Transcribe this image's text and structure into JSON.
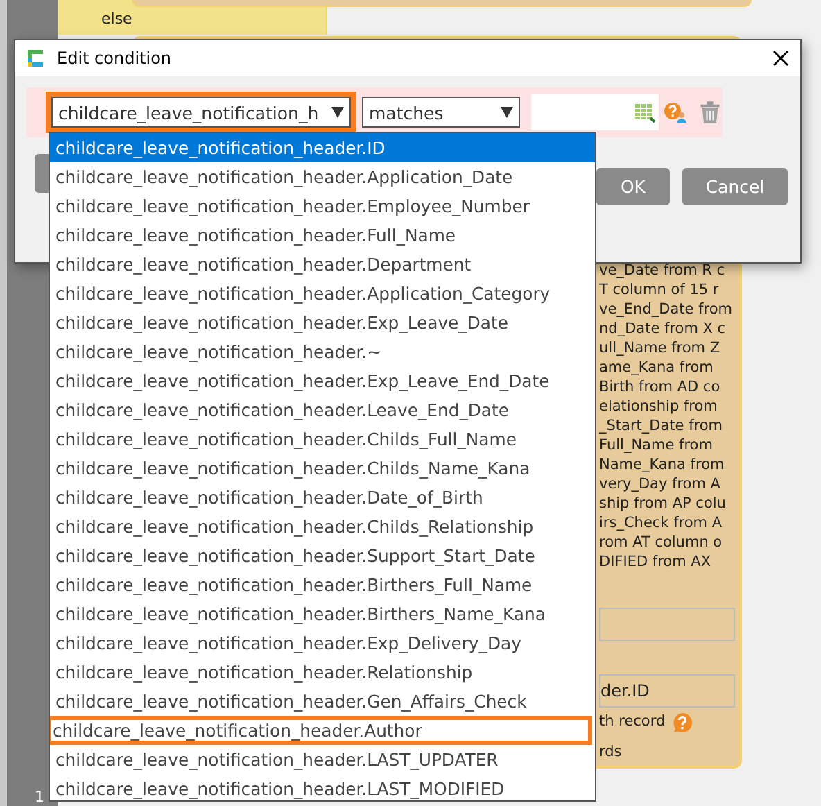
{
  "background": {
    "else_label": "else",
    "line_number": "1",
    "panel_lines": [
      "ve_Date from R c",
      "T column of 15 r",
      "ve_End_Date from",
      "nd_Date from X c",
      "ull_Name from Z",
      "ame_Kana from",
      "Birth from AD co",
      "elationship from",
      "_Start_Date from",
      "Full_Name from",
      "Name_Kana from",
      "very_Day from A",
      "ship from AP colu",
      "irs_Check from A",
      "rom AT column o",
      "DIFIED from AX"
    ],
    "panel_field_value": "der.ID",
    "panel_option": "th record",
    "panel_footer": "rds"
  },
  "dialog": {
    "title": "Edit condition",
    "condition": {
      "field": "childcare_leave_notification_h",
      "field_highlighted": true,
      "operator": "matches"
    },
    "buttons": [
      {
        "label": "OK",
        "kind": "primary"
      },
      {
        "label": "Cancel",
        "kind": "secondary"
      }
    ]
  },
  "dropdown": {
    "items": [
      {
        "label": "childcare_leave_notification_header.ID",
        "selected": true,
        "highlighted": false
      },
      {
        "label": "childcare_leave_notification_header.Application_Date",
        "selected": false,
        "highlighted": false
      },
      {
        "label": "childcare_leave_notification_header.Employee_Number",
        "selected": false,
        "highlighted": false
      },
      {
        "label": "childcare_leave_notification_header.Full_Name",
        "selected": false,
        "highlighted": false
      },
      {
        "label": "childcare_leave_notification_header.Department",
        "selected": false,
        "highlighted": false
      },
      {
        "label": "childcare_leave_notification_header.Application_Category",
        "selected": false,
        "highlighted": false
      },
      {
        "label": "childcare_leave_notification_header.Exp_Leave_Date",
        "selected": false,
        "highlighted": false
      },
      {
        "label": "childcare_leave_notification_header.~",
        "selected": false,
        "highlighted": false
      },
      {
        "label": "childcare_leave_notification_header.Exp_Leave_End_Date",
        "selected": false,
        "highlighted": false
      },
      {
        "label": "childcare_leave_notification_header.Leave_End_Date",
        "selected": false,
        "highlighted": false
      },
      {
        "label": "childcare_leave_notification_header.Childs_Full_Name",
        "selected": false,
        "highlighted": false
      },
      {
        "label": "childcare_leave_notification_header.Childs_Name_Kana",
        "selected": false,
        "highlighted": false
      },
      {
        "label": "childcare_leave_notification_header.Date_of_Birth",
        "selected": false,
        "highlighted": false
      },
      {
        "label": "childcare_leave_notification_header.Childs_Relationship",
        "selected": false,
        "highlighted": false
      },
      {
        "label": "childcare_leave_notification_header.Support_Start_Date",
        "selected": false,
        "highlighted": false
      },
      {
        "label": "childcare_leave_notification_header.Birthers_Full_Name",
        "selected": false,
        "highlighted": false
      },
      {
        "label": "childcare_leave_notification_header.Birthers_Name_Kana",
        "selected": false,
        "highlighted": false
      },
      {
        "label": "childcare_leave_notification_header.Exp_Delivery_Day",
        "selected": false,
        "highlighted": false
      },
      {
        "label": "childcare_leave_notification_header.Relationship",
        "selected": false,
        "highlighted": false
      },
      {
        "label": "childcare_leave_notification_header.Gen_Affairs_Check",
        "selected": false,
        "highlighted": false
      },
      {
        "label": "childcare_leave_notification_header.Author",
        "selected": false,
        "highlighted": true
      },
      {
        "label": "childcare_leave_notification_header.LAST_UPDATER",
        "selected": false,
        "highlighted": false
      },
      {
        "label": "childcare_leave_notification_header.LAST_MODIFIED",
        "selected": false,
        "highlighted": false
      }
    ]
  }
}
